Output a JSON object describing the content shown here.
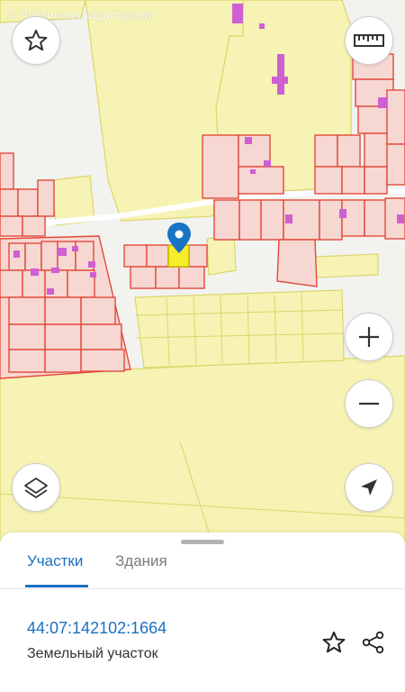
{
  "map": {
    "watermark": "© Публичная кадастровая",
    "colors": {
      "background": "#f2f2ef",
      "land_zone": "#f6f3b4",
      "zone_border": "#dcd66a",
      "parcel_fill": "#f6d7d2",
      "parcel_border": "#e24a3b",
      "building": "#cf5fd2",
      "selected_parcel": "#f6ee2a",
      "pin": "#1a74c4"
    }
  },
  "controls": {
    "favorite": "star-icon",
    "ruler": "ruler-icon",
    "zoom_in": "plus-icon",
    "zoom_out": "minus-icon",
    "layers": "layers-icon",
    "locate": "navigation-arrow-icon"
  },
  "sheet": {
    "tabs": [
      {
        "label": "Участки",
        "active": true
      },
      {
        "label": "Здания",
        "active": false
      }
    ],
    "parcel": {
      "cadastral_number": "44:07:142102:1664",
      "type": "Земельный участок"
    }
  }
}
